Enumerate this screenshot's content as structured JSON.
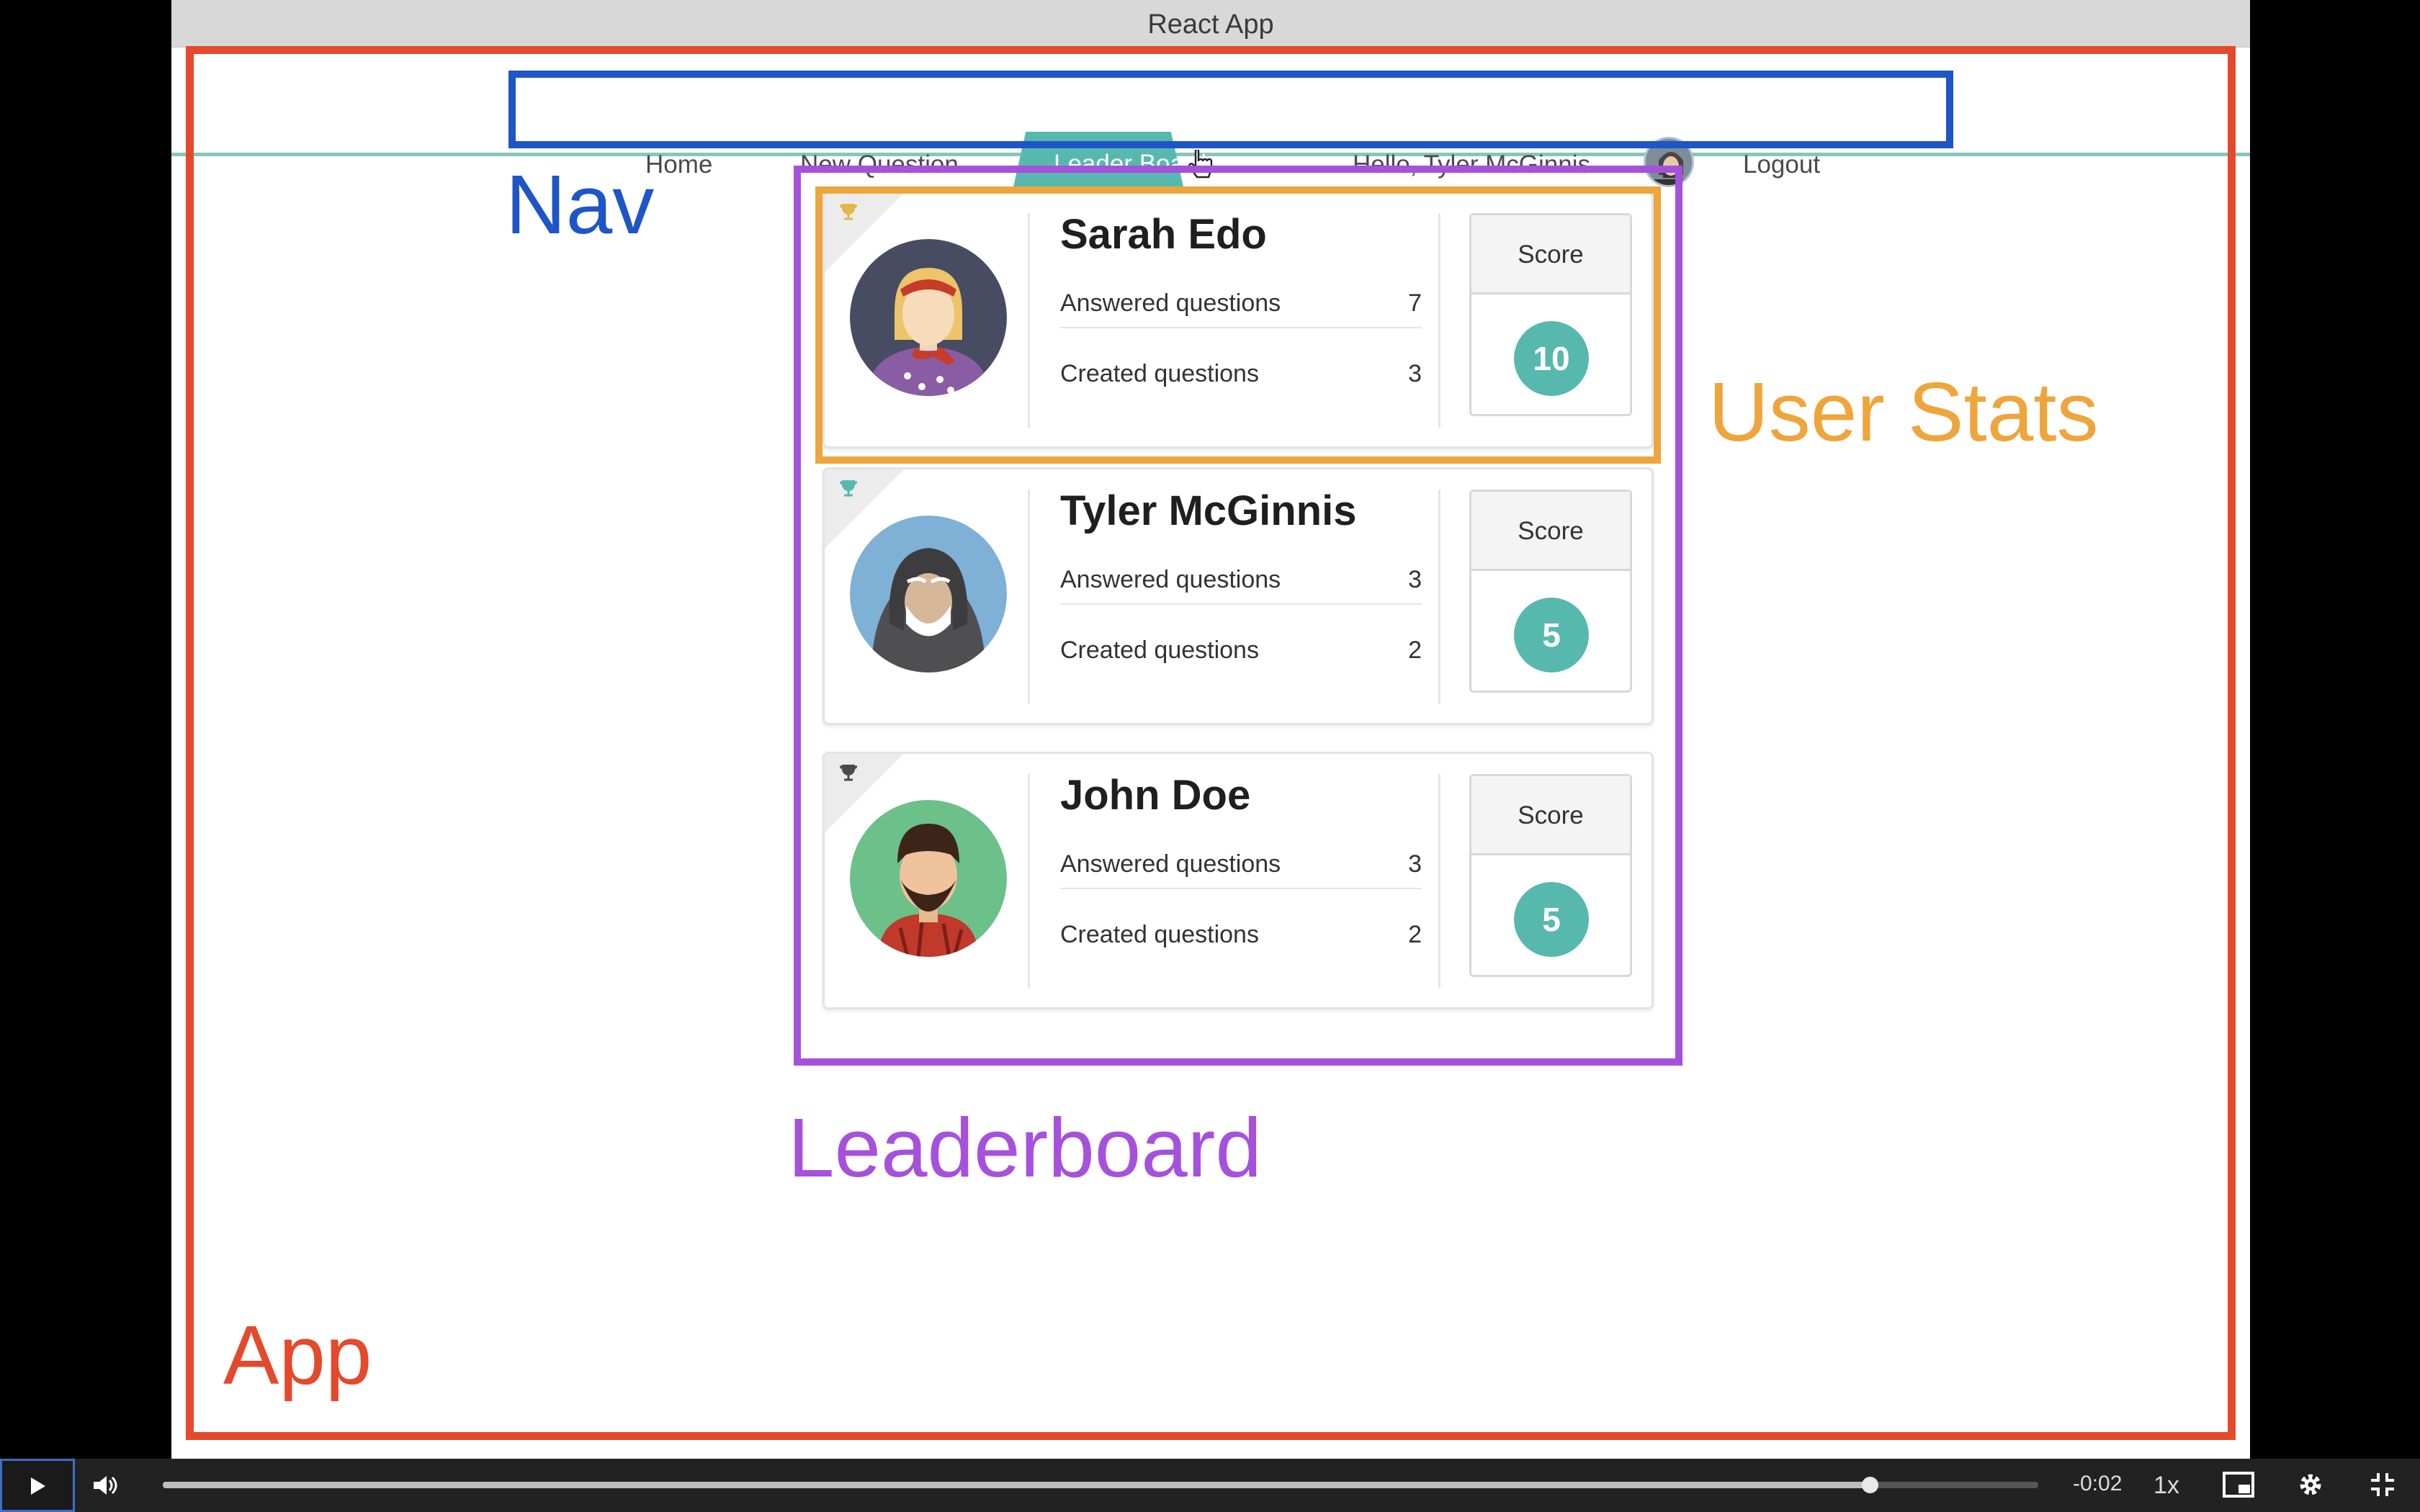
{
  "window": {
    "title": "React App"
  },
  "nav": {
    "items": [
      "Home",
      "New Question",
      "Leader Board"
    ],
    "greeting": "Hello, Tyler McGinnis",
    "logout": "Logout",
    "active": "Leader Board"
  },
  "annotations": {
    "nav": "Nav",
    "user_stats": "User Stats",
    "leaderboard": "Leaderboard",
    "app": "App"
  },
  "leaderboard": {
    "users": [
      {
        "name": "Sarah Edo",
        "answered_label": "Answered questions",
        "answered": "7",
        "created_label": "Created questions",
        "created": "3",
        "score_label": "Score",
        "score": "10",
        "trophy_color": "#e0b84a"
      },
      {
        "name": "Tyler McGinnis",
        "answered_label": "Answered questions",
        "answered": "3",
        "created_label": "Created questions",
        "created": "2",
        "score_label": "Score",
        "score": "5",
        "trophy_color": "#57b9ae"
      },
      {
        "name": "John Doe",
        "answered_label": "Answered questions",
        "answered": "3",
        "created_label": "Created questions",
        "created": "2",
        "score_label": "Score",
        "score": "5",
        "trophy_color": "#4a4a4a"
      }
    ]
  },
  "video": {
    "time_remaining": "-0:02",
    "speed": "1x",
    "progress": 0.91
  },
  "colors": {
    "accent": "#57b9ae",
    "app_border": "#e5492c",
    "nav_border": "#1e55c7",
    "leaderboard_border": "#a651dc",
    "user_stats_border": "#eda53c"
  }
}
